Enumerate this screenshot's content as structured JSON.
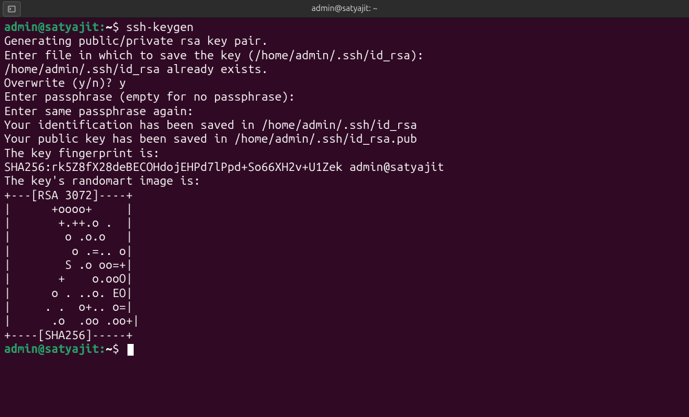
{
  "titlebar": {
    "title": "admin@satyajit: ~"
  },
  "prompt": {
    "user_host": "admin@satyajit",
    "separator": ":",
    "path": "~",
    "dollar": "$"
  },
  "session": {
    "command1": "ssh-keygen",
    "lines": [
      "Generating public/private rsa key pair.",
      "Enter file in which to save the key (/home/admin/.ssh/id_rsa):",
      "/home/admin/.ssh/id_rsa already exists.",
      "Overwrite (y/n)? y",
      "Enter passphrase (empty for no passphrase):",
      "Enter same passphrase again:",
      "Your identification has been saved in /home/admin/.ssh/id_rsa",
      "Your public key has been saved in /home/admin/.ssh/id_rsa.pub",
      "The key fingerprint is:",
      "SHA256:rk5Z8fX28deBECOHdojEHPd7lPpd+So66XH2v+U1Zek admin@satyajit",
      "The key's randomart image is:",
      "+---[RSA 3072]----+",
      "|      +oooo+     |",
      "|       +.++.o .  |",
      "|        o .o.o   |",
      "|         o .=.. o|",
      "|        S .o oo=+|",
      "|       +    o.ooO|",
      "|      o . ..o. EO|",
      "|     . .  o+.. o=|",
      "|      .o  .oo .oo+|",
      "+----[SHA256]-----+"
    ]
  }
}
